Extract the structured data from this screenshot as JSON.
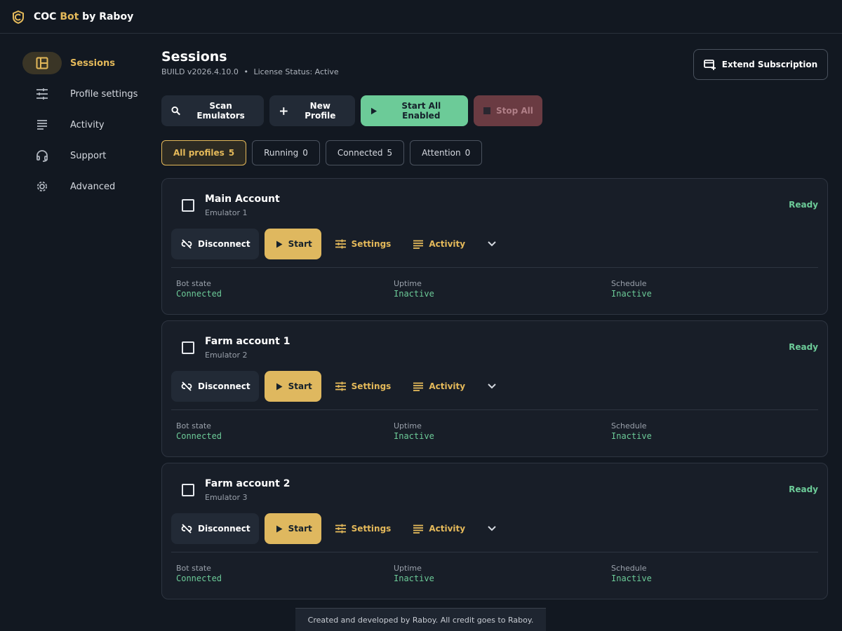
{
  "app": {
    "title_prefix": "COC ",
    "title_accent": "Bot",
    "title_suffix": " by Raboy",
    "accent_color": "#e4b95a"
  },
  "sidebar": {
    "items": [
      {
        "label": "Sessions",
        "icon": "dashboard-icon",
        "active": true
      },
      {
        "label": "Profile settings",
        "icon": "sliders-icon"
      },
      {
        "label": "Activity",
        "icon": "lines-icon"
      },
      {
        "label": "Support",
        "icon": "headset-icon"
      },
      {
        "label": "Advanced",
        "icon": "gear-icon"
      }
    ]
  },
  "header": {
    "title": "Sessions",
    "build": "BUILD v2026.4.10.0",
    "separator": "•",
    "license": "License Status: Active",
    "extend_label": "Extend Subscription"
  },
  "toolbar": {
    "scan_label": "Scan Emulators",
    "new_label": "New Profile",
    "start_all_label": "Start All Enabled",
    "stop_all_label": "Stop All"
  },
  "filters": [
    {
      "label": "All profiles",
      "count": "5",
      "active": true
    },
    {
      "label": "Running",
      "count": "0"
    },
    {
      "label": "Connected",
      "count": "5"
    },
    {
      "label": "Attention",
      "count": "0"
    }
  ],
  "card_labels": {
    "disconnect": "Disconnect",
    "start": "Start",
    "settings": "Settings",
    "activity": "Activity",
    "bot_state": "Bot state",
    "uptime": "Uptime",
    "schedule": "Schedule"
  },
  "profiles": [
    {
      "name": "Main Account",
      "emulator": "Emulator 1",
      "status": "Ready",
      "bot_state": "Connected",
      "uptime": "Inactive",
      "schedule": "Inactive"
    },
    {
      "name": "Farm account 1",
      "emulator": "Emulator 2",
      "status": "Ready",
      "bot_state": "Connected",
      "uptime": "Inactive",
      "schedule": "Inactive"
    },
    {
      "name": "Farm account 2",
      "emulator": "Emulator 3",
      "status": "Ready",
      "bot_state": "Connected",
      "uptime": "Inactive",
      "schedule": "Inactive"
    }
  ],
  "footer": {
    "text": "Created and developed by Raboy. All credit goes to Raboy."
  }
}
